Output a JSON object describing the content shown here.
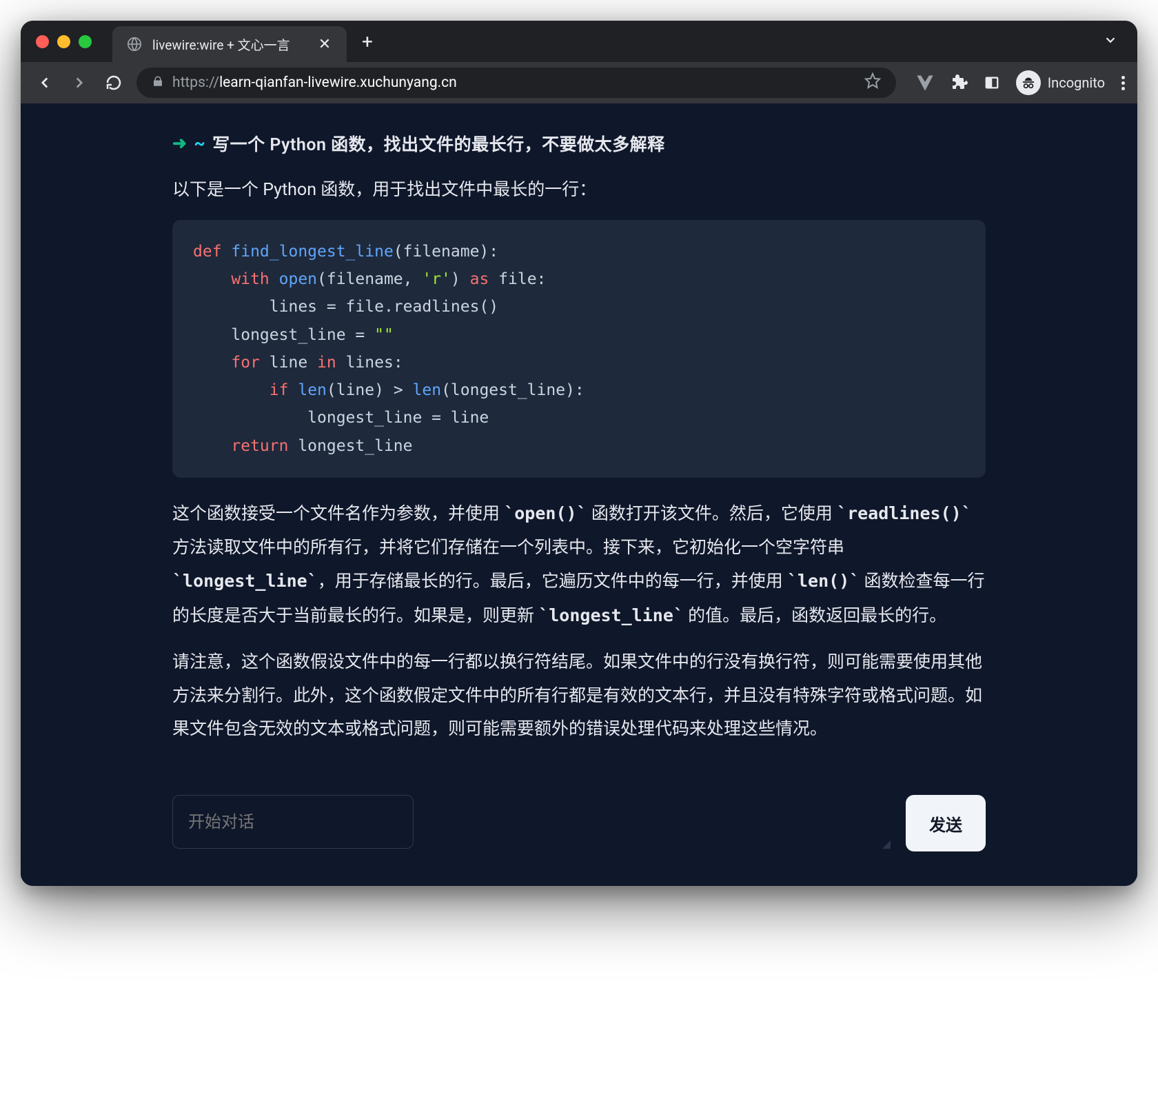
{
  "window": {
    "tab_title": "livewire:wire + 文心一言",
    "url_scheme": "https://",
    "url_rest": "learn-qianfan-livewire.xuchunyang.cn",
    "incognito_label": "Incognito"
  },
  "chat": {
    "prompt": "写一个 Python 函数，找出文件的最长行，不要做太多解释",
    "intro": "以下是一个 Python 函数，用于找出文件中最长的一行：",
    "code": {
      "l1_def": "def",
      "l1_fn": " find_longest_line",
      "l1_rest": "(filename):",
      "l2a": "    ",
      "l2_with": "with",
      "l2_open": " open",
      "l2_args": "(filename, ",
      "l2_str": "'r'",
      "l2_par": ") ",
      "l2_as": "as",
      "l2_file": " file:",
      "l3": "        lines = file.readlines()",
      "l4": "    longest_line = ",
      "l4_str": "\"\"",
      "l5a": "    ",
      "l5_for": "for",
      "l5_mid": " line ",
      "l5_in": "in",
      "l5_rest": " lines:",
      "l6a": "        ",
      "l6_if": "if",
      "l6_sp": " ",
      "l6_len1": "len",
      "l6_mid": "(line) > ",
      "l6_len2": "len",
      "l6_rest": "(longest_line):",
      "l7": "            longest_line = line",
      "l8a": "    ",
      "l8_ret": "return",
      "l8_rest": " longest_line"
    },
    "para1_a": "这个函数接受一个文件名作为参数，并使用 ",
    "para1_c1": "`open()`",
    "para1_b": " 函数打开该文件。然后，它使用 ",
    "para1_c2": "`readlines()`",
    "para1_c": " 方法读取文件中的所有行，并将它们存储在一个列表中。接下来，它初始化一个空字符串 ",
    "para1_c3": "`longest_line`",
    "para1_d": "，用于存储最长的行。最后，它遍历文件中的每一行，并使用 ",
    "para1_c4": "`len()`",
    "para1_e": " 函数检查每一行的长度是否大于当前最长的行。如果是，则更新 ",
    "para1_c5": "`longest_line`",
    "para1_f": " 的值。最后，函数返回最长的行。",
    "para2": "请注意，这个函数假设文件中的每一行都以换行符结尾。如果文件中的行没有换行符，则可能需要使用其他方法来分割行。此外，这个函数假定文件中的所有行都是有效的文本行，并且没有特殊字符或格式问题。如果文件包含无效的文本或格式问题，则可能需要额外的错误处理代码来处理这些情况。",
    "input_placeholder": "开始对话",
    "send_label": "发送"
  }
}
